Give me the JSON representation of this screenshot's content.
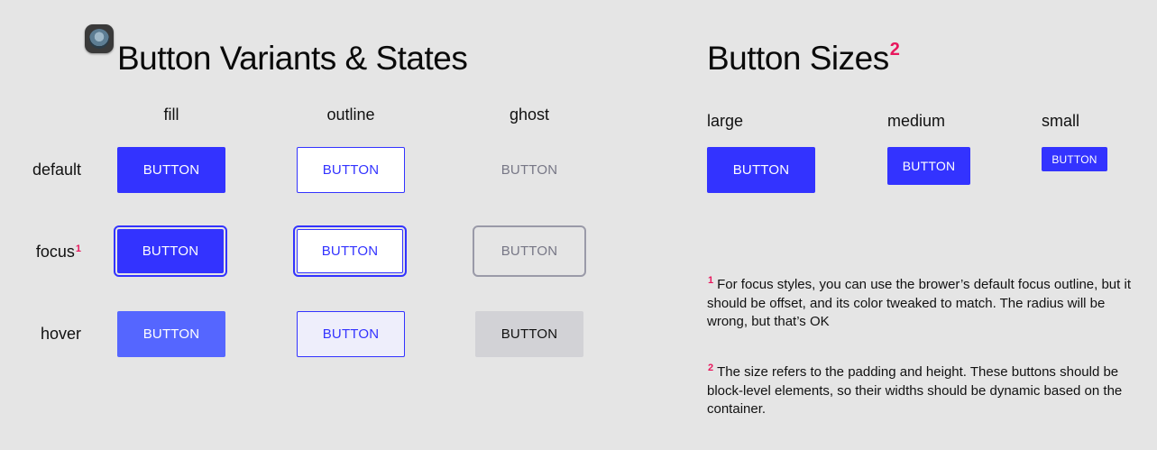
{
  "variants_section": {
    "title": "Button Variants & States",
    "columns": [
      "fill",
      "outline",
      "ghost"
    ],
    "rows": [
      "default",
      "focus",
      "hover"
    ],
    "focus_marker": "1",
    "button_label": "BUTTON"
  },
  "sizes_section": {
    "title": "Button Sizes",
    "title_marker": "2",
    "sizes": [
      "large",
      "medium",
      "small"
    ],
    "button_label": "BUTTON"
  },
  "notes": [
    {
      "marker": "1",
      "text": "For focus styles, you can use the brower’s default focus outline, but it should be offset, and its color tweaked to match. The radius will be wrong, but that’s OK"
    },
    {
      "marker": "2",
      "text": "The size refers to the padding and height. These buttons should be block-level elements, so their widths should be dynamic based on the container."
    }
  ],
  "colors": {
    "primary": "#3333ff",
    "primary_hover": "#5566ff",
    "outline_hover_bg": "#eeeefb",
    "ghost_text": "#777786",
    "ghost_hover_bg": "#d2d2d6",
    "accent_marker": "#e8175d",
    "background": "#e5e5e5"
  }
}
